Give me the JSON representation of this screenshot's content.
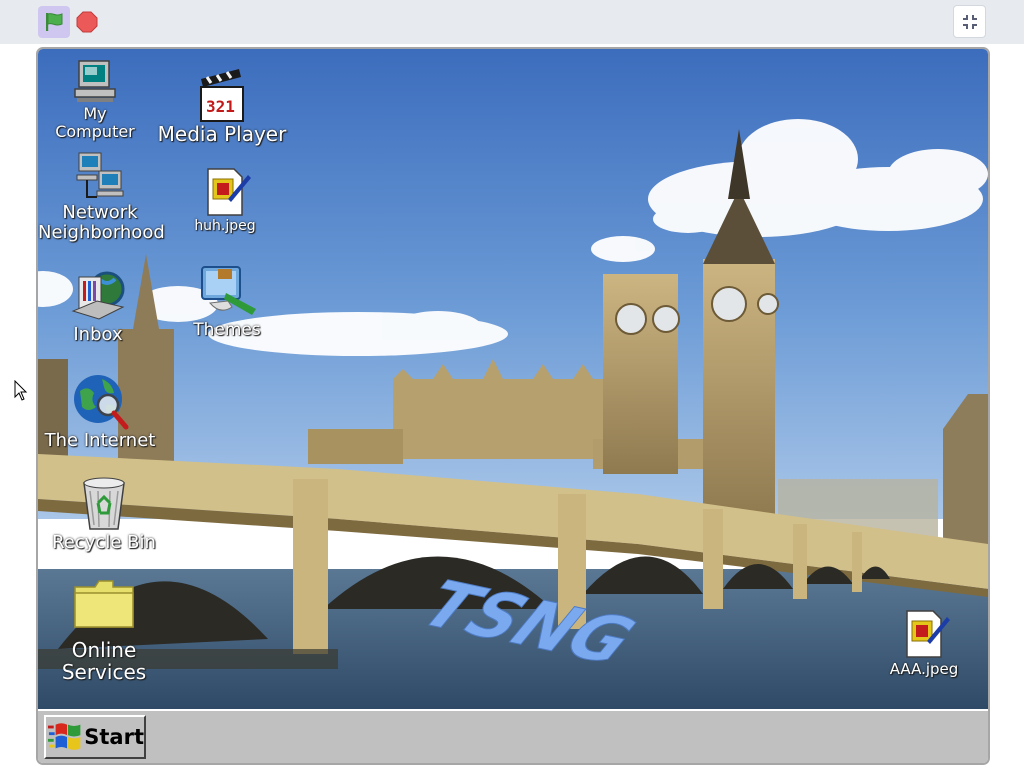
{
  "colors": {
    "topbar_bg": "#e7ebf0",
    "flag_button_bg": "#cfc7ef",
    "flag_green": "#4cae4c",
    "stop_red": "#ec5959",
    "taskbar_gray": "#c0c0c0",
    "sky": "#3f73bf",
    "water": "#3d5e7e"
  },
  "toolbar": {
    "green_flag_icon": "green-flag-icon",
    "stop_icon": "stop-sign-icon",
    "fullscreen_icon": "exit-fullscreen-icon"
  },
  "desktop": {
    "icons": [
      {
        "label": "My Computer",
        "icon": "my-computer-icon"
      },
      {
        "label": "Media Player",
        "icon": "media-player-clapperboard-icon"
      },
      {
        "label": "Network\nNeighborhood",
        "icon": "network-neighborhood-icon"
      },
      {
        "label": "huh.jpeg",
        "icon": "image-file-icon"
      },
      {
        "label": "Inbox",
        "icon": "inbox-icon"
      },
      {
        "label": "Themes",
        "icon": "themes-icon"
      },
      {
        "label": "The Internet",
        "icon": "internet-globe-icon"
      },
      {
        "label": "Recycle Bin",
        "icon": "recycle-bin-icon"
      },
      {
        "label": "Online\nServices",
        "icon": "folder-icon"
      },
      {
        "label": "AAA.jpeg",
        "icon": "image-file-icon"
      }
    ],
    "wallpaper_text": "TSNG"
  },
  "taskbar": {
    "start_label": "Start",
    "start_icon": "windows-flag-icon"
  }
}
